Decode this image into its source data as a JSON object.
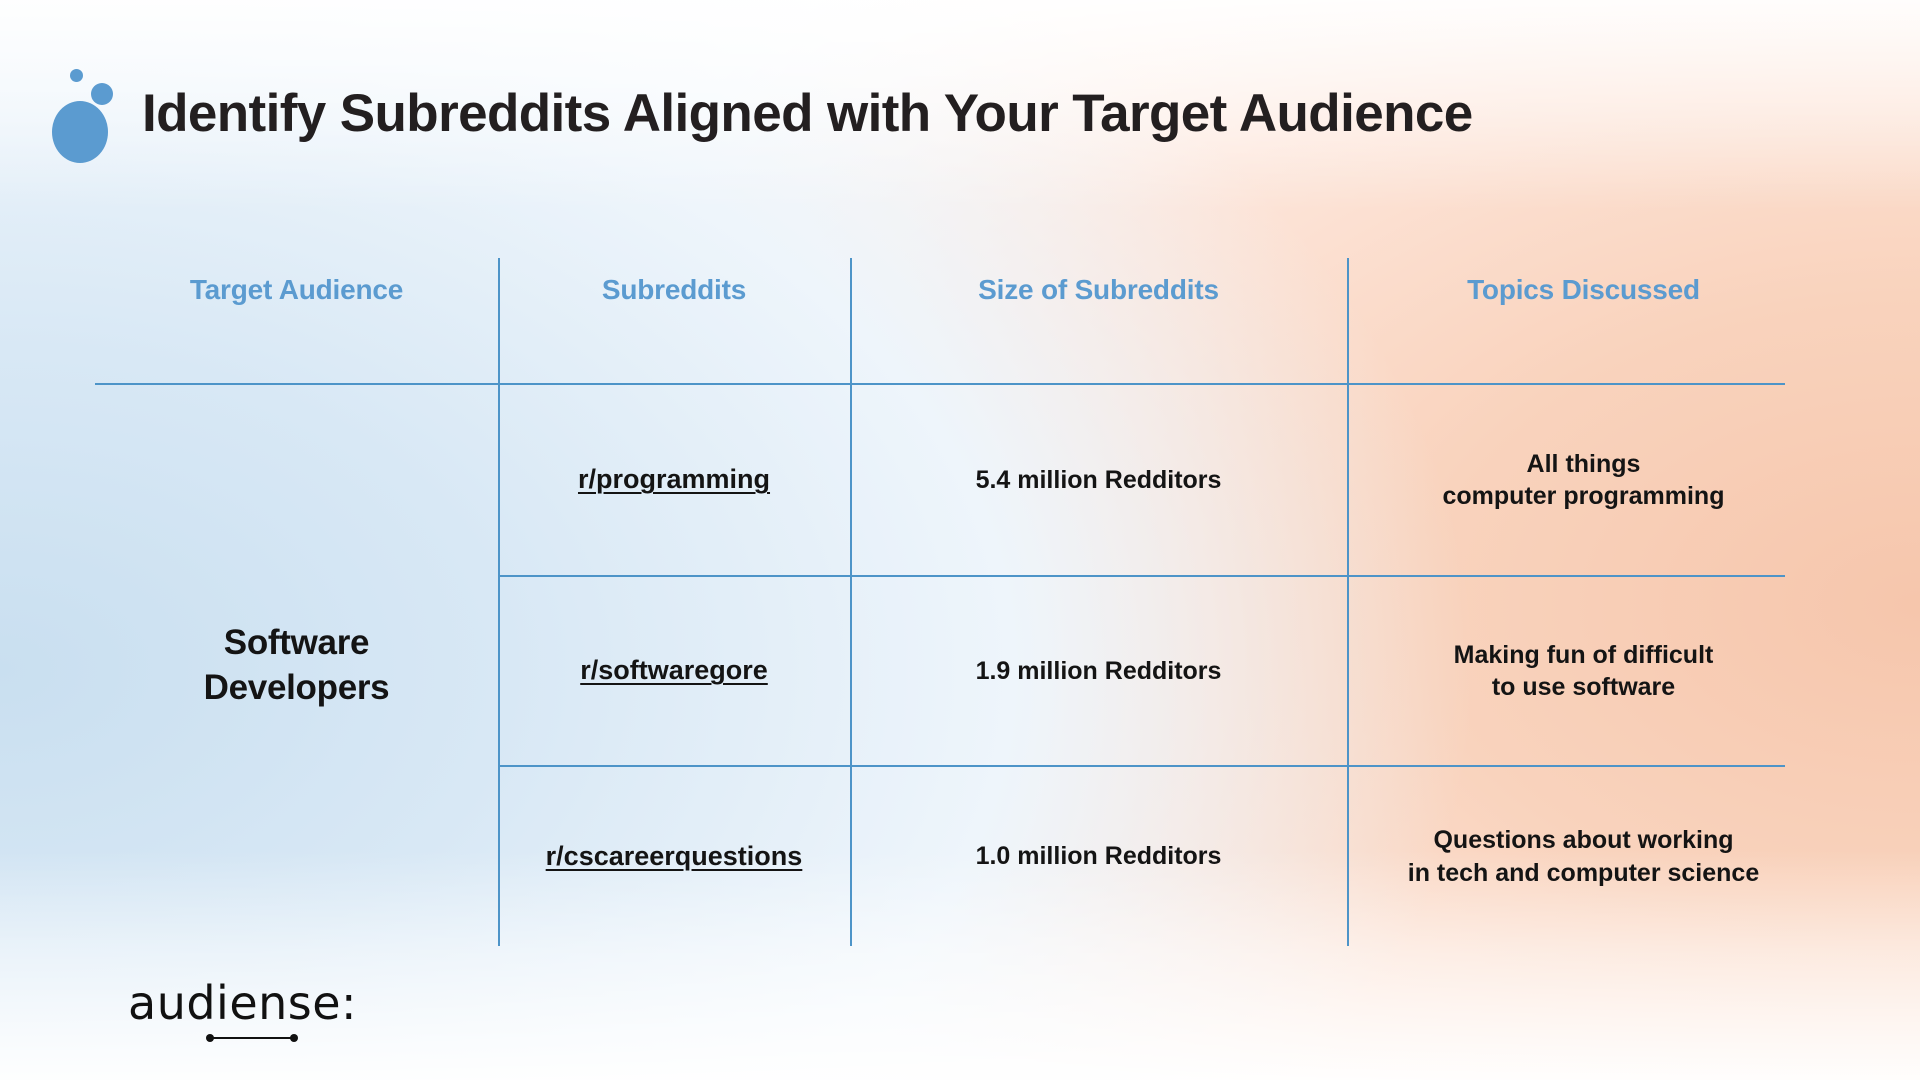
{
  "header": {
    "title": "Identify Subreddits Aligned with Your Target Audience",
    "logo_icon": "audiense-bubbles-icon"
  },
  "colors": {
    "accent_blue": "#5b9bd0",
    "rule_blue": "#4d94c8",
    "text_dark": "#141414",
    "bg_left": "#c9dff0",
    "bg_right": "#f6c6ac"
  },
  "table": {
    "columns": [
      {
        "label": "Target Audience"
      },
      {
        "label": "Subreddits"
      },
      {
        "label": "Size of Subreddits"
      },
      {
        "label": "Topics Discussed"
      }
    ],
    "audience": "Software\nDevelopers",
    "audience_line_1": "Software",
    "audience_line_2": "Developers",
    "rows": [
      {
        "subreddit": "r/programming",
        "size": "5.4 million Redditors",
        "topic_line_1": "All things",
        "topic_line_2": "computer programming"
      },
      {
        "subreddit": "r/softwaregore",
        "size": "1.9 million Redditors",
        "topic_line_1": "Making fun of difficult",
        "topic_line_2": "to use software"
      },
      {
        "subreddit": "r/cscareerquestions",
        "size": "1.0 million Redditors",
        "topic_line_1": "Questions about working",
        "topic_line_2": "in tech and computer science"
      }
    ]
  },
  "footer": {
    "wordmark": "audiense:"
  }
}
